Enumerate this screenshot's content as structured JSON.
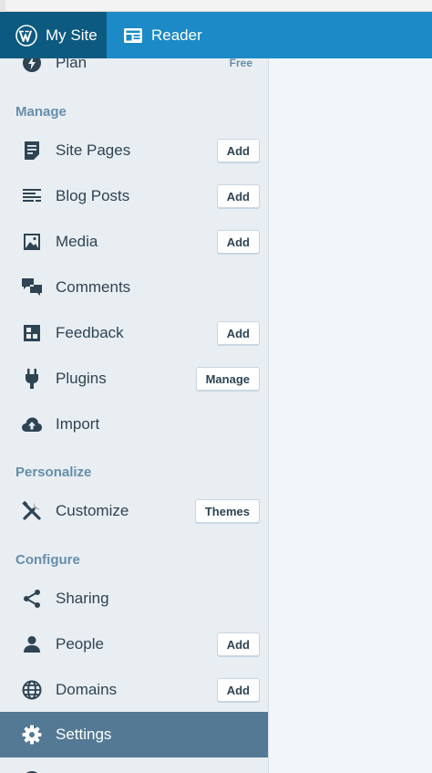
{
  "masterbar": {
    "my_site": "My Site",
    "reader": "Reader"
  },
  "sidebar": {
    "plan": {
      "label": "Plan",
      "badge": "Free"
    },
    "sections": {
      "manage": "Manage",
      "personalize": "Personalize",
      "configure": "Configure"
    },
    "items": {
      "site_pages": {
        "label": "Site Pages",
        "action": "Add"
      },
      "blog_posts": {
        "label": "Blog Posts",
        "action": "Add"
      },
      "media": {
        "label": "Media",
        "action": "Add"
      },
      "comments": {
        "label": "Comments"
      },
      "feedback": {
        "label": "Feedback",
        "action": "Add"
      },
      "plugins": {
        "label": "Plugins",
        "action": "Manage"
      },
      "import": {
        "label": "Import"
      },
      "customize": {
        "label": "Customize",
        "action": "Themes"
      },
      "sharing": {
        "label": "Sharing"
      },
      "people": {
        "label": "People",
        "action": "Add"
      },
      "domains": {
        "label": "Domains",
        "action": "Add"
      },
      "settings": {
        "label": "Settings"
      }
    },
    "selected": "settings"
  },
  "colors": {
    "masterbar": "#1b8ac6",
    "masterbar_active": "#0d5a80",
    "sidebar_bg": "#e9eef3",
    "selected_row": "#537994",
    "heading": "#668eaa",
    "text": "#2e4453"
  },
  "icons": {
    "wordpress": "wordpress-logo-icon",
    "reader": "reader-icon",
    "plan": "plan-icon",
    "pages": "pages-icon",
    "posts": "posts-icon",
    "media": "image-icon",
    "comments": "comments-icon",
    "feedback": "feedback-icon",
    "plugins": "plug-icon",
    "import": "cloud-upload-icon",
    "customize": "tools-icon",
    "sharing": "share-icon",
    "people": "person-icon",
    "domains": "globe-icon",
    "settings": "gear-icon"
  }
}
